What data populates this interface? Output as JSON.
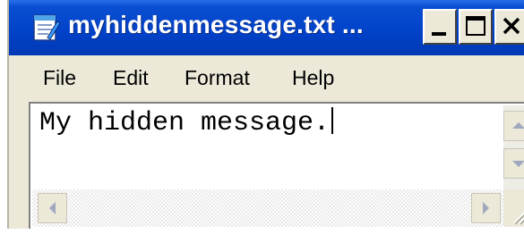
{
  "window": {
    "title": "myhiddenmessage.txt ...",
    "app_icon": "notepad-icon",
    "controls": {
      "minimize_icon": "minimize-icon",
      "maximize_icon": "maximize-icon",
      "close_icon": "close-icon"
    }
  },
  "menubar": {
    "items": [
      {
        "label": "File"
      },
      {
        "label": "Edit"
      },
      {
        "label": "Format"
      },
      {
        "label": "Help"
      }
    ]
  },
  "editor": {
    "content": "My hidden message."
  },
  "colors": {
    "titlebar": "#0041c8",
    "chrome": "#ece9d8",
    "text": "#000000"
  }
}
